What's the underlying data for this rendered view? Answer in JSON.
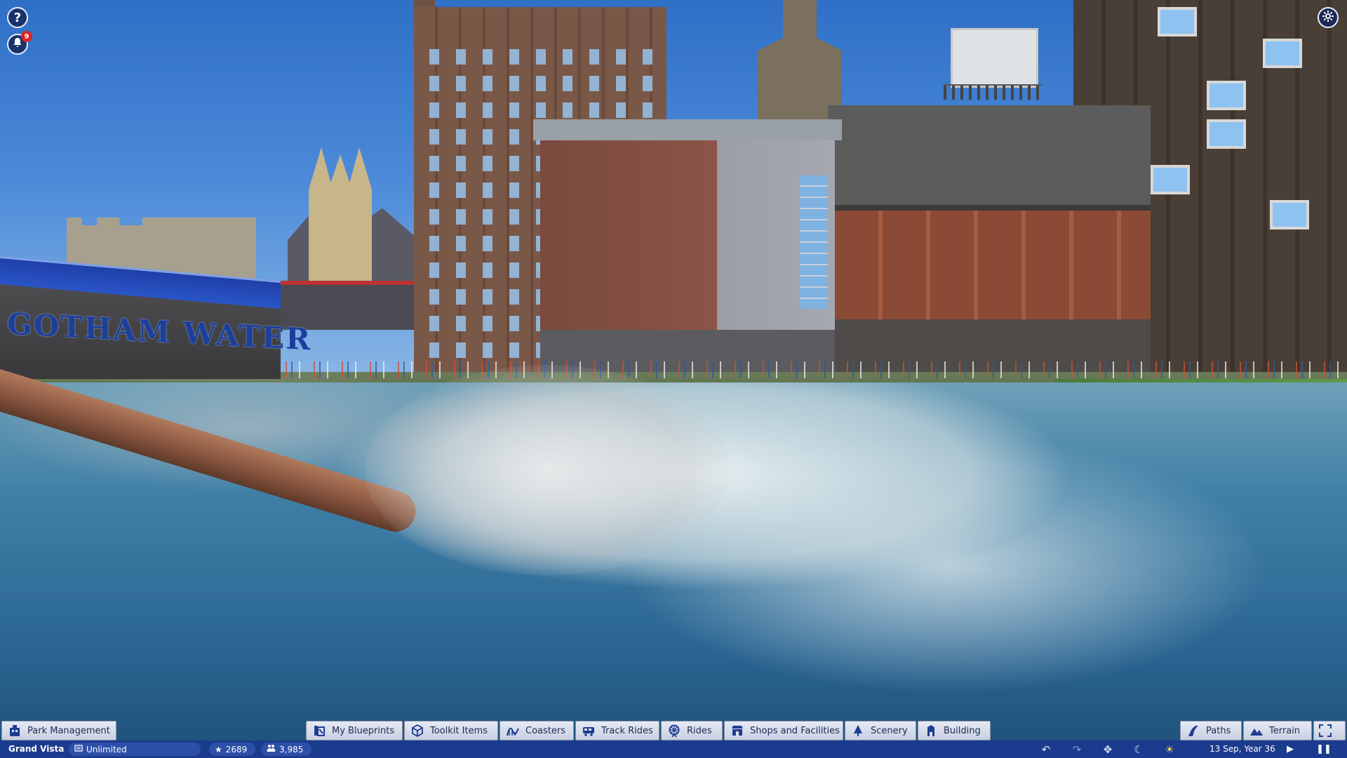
{
  "hud": {
    "help_label": "?",
    "notifications_count": "9",
    "settings_icon": "gear-icon"
  },
  "scene": {
    "sign_text": "GOTHAM WATER"
  },
  "toolbar": {
    "park_management": "Park Management",
    "my_blueprints": "My Blueprints",
    "toolkit_items": "Toolkit Items",
    "coasters": "Coasters",
    "track_rides": "Track Rides",
    "rides": "Rides",
    "shops_and_facilities": "Shops and Facilities",
    "scenery": "Scenery",
    "building": "Building",
    "paths": "Paths",
    "terrain": "Terrain"
  },
  "status": {
    "park_name": "Grand Vista",
    "money": "Unlimited",
    "rating": "2689",
    "guests": "3,985",
    "date": "13 Sep, Year 36"
  },
  "colors": {
    "toolbar_bg": "#dde3ef",
    "statusbar_bg": "#1b3b8e",
    "accent": "#1d3d92",
    "notification_badge": "#d92424"
  }
}
